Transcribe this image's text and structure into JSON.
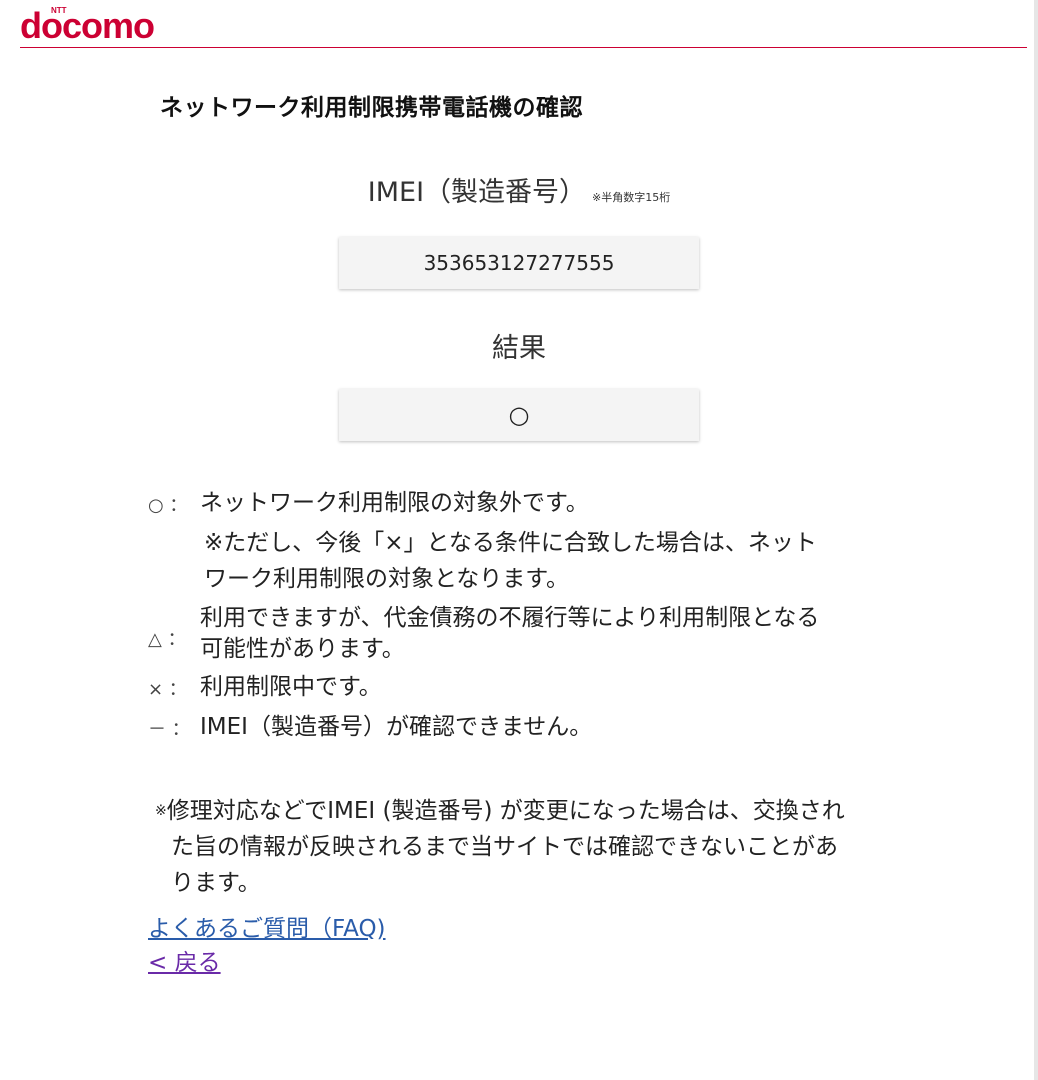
{
  "header": {
    "logo_text": "docomo",
    "logo_ntt": "NTT",
    "brand_color": "#cc0033"
  },
  "page_title": "ネットワーク利用制限携帯電話機の確認",
  "imei": {
    "label": "IMEI（製造番号）",
    "note": "※半角数字15桁",
    "value": "353653127277555"
  },
  "result": {
    "label": "結果",
    "value": "○"
  },
  "legend": [
    {
      "mark": "○ ：",
      "text": "ネットワーク利用制限の対象外です。",
      "sub": [
        "※ただし、今後「×」となる条件に合致した場合は、ネット",
        "ワーク利用制限の対象となります。"
      ]
    },
    {
      "mark": "△ ：",
      "text_lines": [
        "利用できますが、代金債務の不履行等により利用制限となる",
        "可能性があります。"
      ]
    },
    {
      "mark": "× ：",
      "text": "利用制限中です。"
    },
    {
      "mark": "－ ：",
      "text": "IMEI（製造番号）が確認できません。"
    }
  ],
  "notice": {
    "mark": "※",
    "line1": "修理対応などでIMEI (製造番号) が変更になった場合は、交換され",
    "line2": "た旨の情報が反映されるまで当サイトでは確認できないことがあ",
    "line3": "ります。"
  },
  "links": {
    "faq": "よくあるご質問（FAQ)",
    "back": "< 戻る"
  }
}
